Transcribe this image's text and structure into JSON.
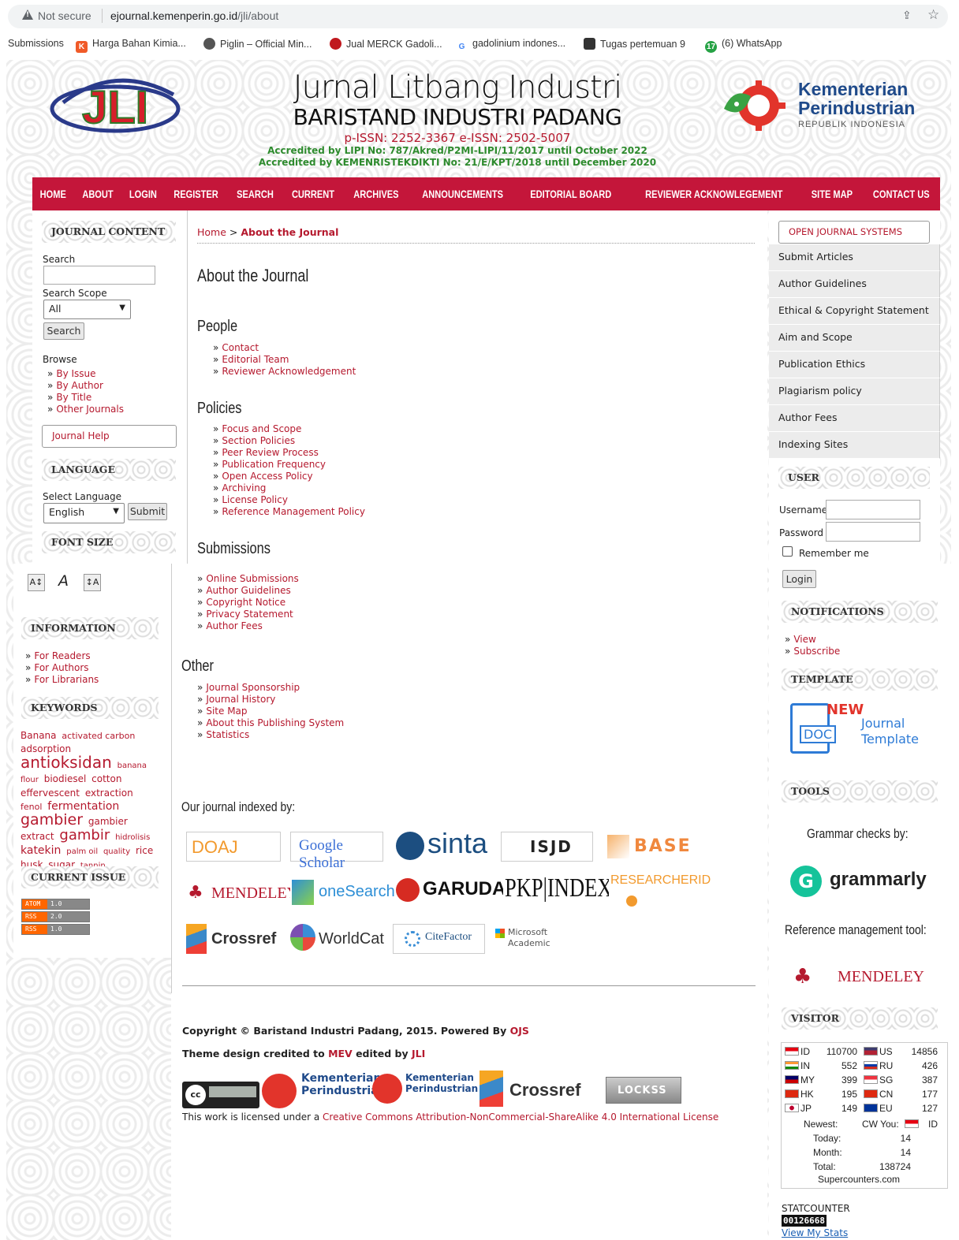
{
  "browser": {
    "not_secure": "Not secure",
    "url_host": "ejournal.kemenperin.go.id",
    "url_path": "/jli/about"
  },
  "bookmarks": [
    {
      "label": "Submissions",
      "icon": "none",
      "color": ""
    },
    {
      "label": "Harga Bahan Kimia...",
      "icon": "K",
      "color": "#f05a28"
    },
    {
      "label": "Piglin – Official Min...",
      "icon": "globe",
      "color": "#555555"
    },
    {
      "label": "Jual MERCK Gadoli...",
      "icon": "dot",
      "color": "#c0181e"
    },
    {
      "label": "gadolinium indones...",
      "icon": "G",
      "color": "#4285f4"
    },
    {
      "label": "Tugas pertemuan 9",
      "icon": "card",
      "color": "#333333"
    },
    {
      "label": "(6) WhatsApp",
      "icon": "17",
      "color": "#25a244"
    }
  ],
  "header": {
    "logo_text": "JLI",
    "title": "Jurnal Litbang Industri",
    "subtitle": "BARISTAND INDUSTRI PADANG",
    "issn": "p-ISSN: 2252-3367   e-ISSN: 2502-5007",
    "accreditation_1": "Accredited by LIPI No: 787/Akred/P2MI-LIPI/11/2017 until October 2022",
    "accreditation_2": "Accredited by KEMENRISTEKDIKTI No: 21/E/KPT/2018 until December 2020",
    "ministry_1": "Kementerian",
    "ministry_2": "Perindustrian",
    "ministry_3": "REPUBLIK INDONESIA"
  },
  "nav": [
    "HOME",
    "ABOUT",
    "LOGIN",
    "REGISTER",
    "SEARCH",
    "CURRENT",
    "ARCHIVES",
    "ANNOUNCEMENTS",
    "EDITORIAL BOARD",
    "REVIEWER ACKNOWLEGEMENT",
    "SITE MAP",
    "CONTACT US"
  ],
  "left": {
    "journal_content": "JOURNAL CONTENT",
    "search_label": "Search",
    "search_value": "",
    "scope_label": "Search Scope",
    "scope_value": "All",
    "search_button": "Search",
    "browse_label": "Browse",
    "browse_links": [
      "By Issue",
      "By Author",
      "By Title",
      "Other Journals"
    ],
    "journal_help": "Journal Help",
    "language_title": "LANGUAGE",
    "select_language": "Select Language",
    "language_value": "English",
    "submit_button": "Submit",
    "font_size_title": "FONT SIZE",
    "information_title": "INFORMATION",
    "information_links": [
      "For Readers",
      "For Authors",
      "For Librarians"
    ],
    "keywords_title": "KEYWORDS",
    "keywords": [
      {
        "t": "Banana",
        "s": 12
      },
      {
        "t": "activated carbon",
        "s": 11
      },
      {
        "t": "adsorption",
        "s": 12
      },
      {
        "t": "antioksidan",
        "s": 20
      },
      {
        "t": "banana flour",
        "s": 10
      },
      {
        "t": "biodiesel",
        "s": 12
      },
      {
        "t": "cotton",
        "s": 12
      },
      {
        "t": "effervescent",
        "s": 12
      },
      {
        "t": "extraction",
        "s": 12
      },
      {
        "t": "fenol",
        "s": 11
      },
      {
        "t": "fermentation",
        "s": 14
      },
      {
        "t": "gambier",
        "s": 19
      },
      {
        "t": "gambier extract",
        "s": 12
      },
      {
        "t": "gambir",
        "s": 18
      },
      {
        "t": "hidrolisis",
        "s": 10
      },
      {
        "t": "katekin",
        "s": 14
      },
      {
        "t": "palm oil",
        "s": 10
      },
      {
        "t": "quality",
        "s": 10
      },
      {
        "t": "rice husk",
        "s": 12
      },
      {
        "t": "sugar",
        "s": 12
      },
      {
        "t": "tannin",
        "s": 10
      }
    ],
    "current_issue_title": "CURRENT ISSUE",
    "feeds": [
      [
        "ATOM",
        "1.0"
      ],
      [
        "RSS",
        "2.0"
      ],
      [
        "RSS",
        "1.0"
      ]
    ]
  },
  "main": {
    "breadcrumb_home": "Home",
    "breadcrumb_current": "About the Journal",
    "page_title": "About the Journal",
    "people_title": "People",
    "people_links": [
      "Contact",
      "Editorial Team",
      "Reviewer Acknowledgement"
    ],
    "policies_title": "Policies",
    "policies_links": [
      "Focus and Scope",
      "Section Policies",
      "Peer Review Process",
      "Publication Frequency",
      "Open Access Policy",
      "Archiving",
      "License Policy",
      "Reference Management Policy"
    ],
    "submissions_title": "Submissions",
    "submissions_links": [
      "Online Submissions",
      "Author Guidelines",
      "Copyright Notice",
      "Privacy Statement",
      "Author Fees"
    ],
    "other_title": "Other",
    "other_links": [
      "Journal Sponsorship",
      "Journal History",
      "Site Map",
      "About this Publishing System",
      "Statistics"
    ],
    "indexed_by": "Our journal indexed by:",
    "indexers": [
      "DOAJ",
      "Google Scholar",
      "sinta",
      "ISJD",
      "BASE",
      "MENDELEY",
      "oneSearch",
      "GARUDA",
      "PKP|INDEX",
      "RESEARCHERID",
      "Crossref",
      "WorldCat",
      "CiteFactor",
      "Microsoft Academic"
    ],
    "copyright_text": "Copyright © Baristand Industri Padang, 2015. Powered By ",
    "copyright_link": "OJS",
    "theme_text": "Theme design credited to ",
    "theme_link1": "MEV",
    "theme_mid": " edited by ",
    "theme_link2": "JLI",
    "footer_logos": [
      "Kementerian Perindustrian",
      "Kementerian Perindustrian",
      "Crossref",
      "LOCKSS"
    ],
    "license_text": "This work is licensed under a ",
    "license_link": "Creative Commons Attribution-NonCommercial-ShareAlike 4.0 International License"
  },
  "right": {
    "ojs_button": "OPEN JOURNAL SYSTEMS",
    "menu": [
      "Submit Articles",
      "Author Guidelines",
      "Ethical & Copyright Statement",
      "Aim and Scope",
      "Publication Ethics",
      "Plagiarism policy",
      "Author Fees",
      "Indexing Sites"
    ],
    "user_title": "USER",
    "username_label": "Username",
    "password_label": "Password",
    "remember_label": "Remember me",
    "login_button": "Login",
    "notifications_title": "NOTIFICATIONS",
    "notification_links": [
      "View",
      "Subscribe"
    ],
    "template_title": "TEMPLATE",
    "template_new": "NEW",
    "template_doc": "DOC",
    "template_text_1": "Journal",
    "template_text_2": "Template",
    "tools_title": "TOOLS",
    "grammar_label": "Grammar checks by:",
    "grammarly": "grammarly",
    "ref_label": "Reference management tool:",
    "mendeley": "MENDELEY",
    "visitor_title": "VISITOR",
    "visitors": [
      {
        "c1": "ID",
        "n1": "110700",
        "c2": "US",
        "n2": "14856"
      },
      {
        "c1": "IN",
        "n1": "552",
        "c2": "RU",
        "n2": "426"
      },
      {
        "c1": "MY",
        "n1": "399",
        "c2": "SG",
        "n2": "387"
      },
      {
        "c1": "HK",
        "n1": "195",
        "c2": "CN",
        "n2": "177"
      },
      {
        "c1": "JP",
        "n1": "149",
        "c2": "EU",
        "n2": "127"
      }
    ],
    "newest_label": "Newest:",
    "newest_value": "CW You:",
    "newest_country": "ID",
    "today_label": "Today:",
    "today_value": "14",
    "month_label": "Month:",
    "month_value": "14",
    "total_label": "Total:",
    "total_value": "138724",
    "supercounters": "Supercounters.com",
    "statcounter_label": "STATCOUNTER",
    "statcounter_value": "00126668",
    "view_stats": "View My Stats"
  }
}
